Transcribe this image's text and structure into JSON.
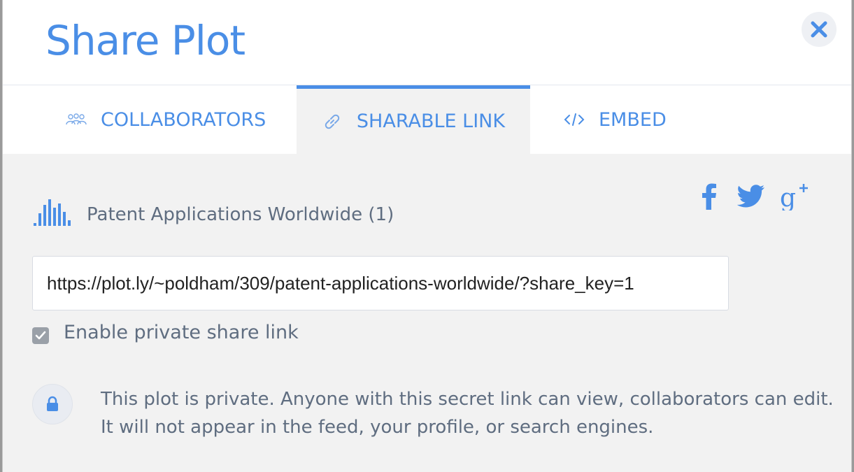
{
  "dialog": {
    "title": "Share Plot",
    "close_icon": "close-icon"
  },
  "tabs": [
    {
      "label": "COLLABORATORS",
      "icon": "users-icon",
      "active": false
    },
    {
      "label": "SHARABLE LINK",
      "icon": "link-icon",
      "active": true
    },
    {
      "label": "EMBED",
      "icon": "code-icon",
      "active": false
    }
  ],
  "plot": {
    "icon": "bar-chart-icon",
    "name": "Patent Applications Worldwide (1)"
  },
  "share": {
    "facebook_icon": "facebook-icon",
    "twitter_icon": "twitter-icon",
    "google_plus_icon": "google-plus-icon"
  },
  "link": {
    "url": "https://plot.ly/~poldham/309/patent-applications-worldwide/?share_key=1"
  },
  "private_link": {
    "checked": true,
    "label": "Enable private share link"
  },
  "notice": {
    "icon": "lock-icon",
    "line1": "This plot is private. Anyone with this secret link can view, collaborators can edit.",
    "line2": "It will not appear in the feed, your profile, or search engines."
  },
  "colors": {
    "accent": "#4a8ee6",
    "text_muted": "#5f6d80",
    "panel_bg": "#f2f2f2"
  }
}
